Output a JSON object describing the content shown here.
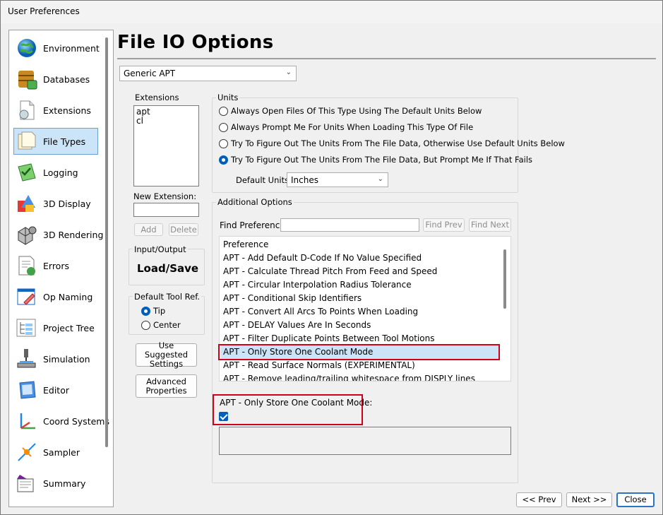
{
  "window": {
    "title": "User Preferences"
  },
  "sidebar": {
    "items": [
      {
        "label": "Environment",
        "icon": "globe-icon"
      },
      {
        "label": "Databases",
        "icon": "database-icon"
      },
      {
        "label": "Extensions",
        "icon": "file-extension-icon"
      },
      {
        "label": "File Types",
        "icon": "file-types-icon",
        "selected": true
      },
      {
        "label": "Logging",
        "icon": "logging-icon"
      },
      {
        "label": "3D Display",
        "icon": "3d-display-icon"
      },
      {
        "label": "3D Rendering",
        "icon": "3d-rendering-icon"
      },
      {
        "label": "Errors",
        "icon": "errors-icon"
      },
      {
        "label": "Op Naming",
        "icon": "op-naming-icon"
      },
      {
        "label": "Project Tree",
        "icon": "project-tree-icon"
      },
      {
        "label": "Simulation",
        "icon": "simulation-icon"
      },
      {
        "label": "Editor",
        "icon": "editor-icon"
      },
      {
        "label": "Coord Systems",
        "icon": "coord-systems-icon"
      },
      {
        "label": "Sampler",
        "icon": "sampler-icon"
      },
      {
        "label": "Summary",
        "icon": "summary-icon"
      }
    ]
  },
  "main": {
    "title": "File IO Options",
    "file_type_select": {
      "value": "Generic APT"
    },
    "extensions": {
      "label": "Extensions",
      "items": [
        "apt",
        "cl"
      ],
      "new_extension_label": "New Extension:",
      "new_extension_value": "",
      "add_label": "Add",
      "delete_label": "Delete"
    },
    "io": {
      "label": "Input/Output",
      "value": "Load/Save"
    },
    "tool_ref": {
      "label": "Default Tool Ref.",
      "options": [
        {
          "label": "Tip",
          "selected": true
        },
        {
          "label": "Center",
          "selected": false
        }
      ]
    },
    "buttons": {
      "use_suggested": "Use Suggested Settings",
      "advanced": "Advanced Properties"
    },
    "units": {
      "label": "Units",
      "options": [
        {
          "label": "Always Open Files Of This Type Using The Default Units Below",
          "selected": false
        },
        {
          "label": "Always Prompt Me For Units When Loading This Type Of File",
          "selected": false
        },
        {
          "label": "Try To Figure Out The Units From The File Data, Otherwise Use Default Units Below",
          "selected": false
        },
        {
          "label": "Try To Figure Out The Units From The File Data, But Prompt Me If That Fails",
          "selected": true
        }
      ],
      "default_units_label": "Default Units:",
      "default_units_value": "Inches"
    },
    "additional": {
      "label": "Additional Options",
      "find_label": "Find Preference",
      "find_value": "",
      "find_prev": "Find Prev",
      "find_next": "Find Next",
      "column_header": "Preference",
      "rows": [
        "APT - Add Default D-Code If No Value Specified",
        "APT - Calculate Thread Pitch From Feed and Speed",
        "APT - Circular Interpolation Radius Tolerance",
        "APT - Conditional Skip Identifiers",
        "APT - Convert All Arcs To Points When Loading",
        "APT - DELAY Values Are In Seconds",
        "APT - Filter Duplicate Points Between Tool Motions",
        "APT - Only Store One Coolant Mode",
        "APT - Read Surface Normals (EXPERIMENTAL)",
        "APT - Remove leading/trailing whitespace from DISPLY lines"
      ],
      "selected_index": 7,
      "detail_label": "APT - Only Store One Coolant Mode:",
      "detail_checked": true,
      "description": ""
    },
    "footer": {
      "prev": "<< Prev",
      "next": "Next >>",
      "close": "Close"
    }
  },
  "colors": {
    "selection": "#cce4f7",
    "accent": "#005fb8",
    "highlight_border": "#d0021b"
  }
}
